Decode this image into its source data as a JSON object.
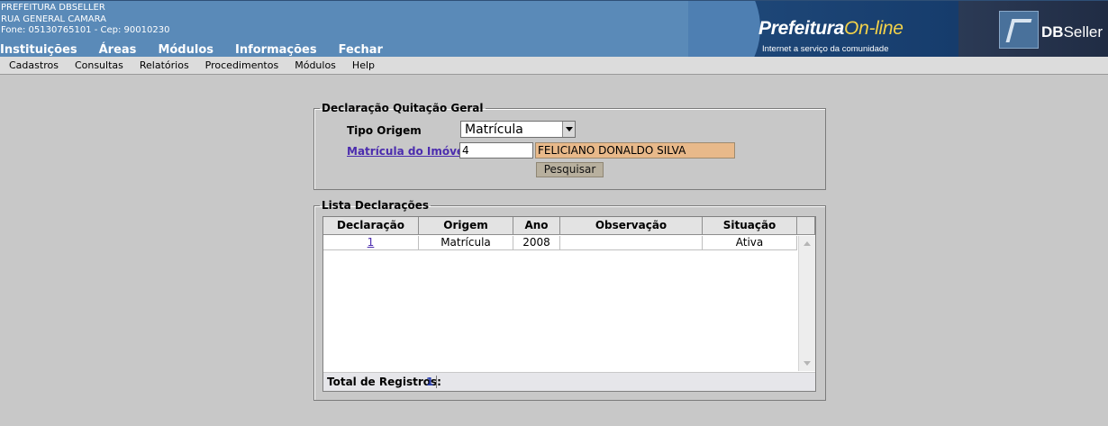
{
  "header": {
    "org_name": "PREFEITURA DBSELLER",
    "address": "RUA GENERAL CAMARA",
    "contact": "Fone: 05130765101  -  Cep: 90010230",
    "nav": [
      "Instituições",
      "Áreas",
      "Módulos",
      "Informações",
      "Fechar"
    ],
    "banner_title_main": "Prefeitura",
    "banner_title_accent": "On-line",
    "banner_subtitle": "Internet a serviço da comunidade",
    "brand_db": "DB",
    "brand_seller": "Seller",
    "colors": {
      "header_bg": "#5a8ab8",
      "banner_bg": "#163c6c",
      "accent": "#f3d24a"
    }
  },
  "menu": [
    "Cadastros",
    "Consultas",
    "Relatórios",
    "Procedimentos",
    "Módulos",
    "Help"
  ],
  "declaracao": {
    "legend": "Declaração Quitação Geral",
    "tipo_origem_label": "Tipo Origem",
    "tipo_origem_value": "Matrícula",
    "matricula_label": "Matrícula do Imóvel:",
    "matricula_value": "4",
    "nome_value": "FELICIANO DONALDO SILVA",
    "pesquisar_label": "Pesquisar"
  },
  "lista": {
    "legend": "Lista Declarações",
    "columns": [
      "Declaração",
      "Origem",
      "Ano",
      "Observação",
      "Situação"
    ],
    "rows": [
      {
        "declaracao": "1",
        "origem": "Matrícula",
        "ano": "2008",
        "observacao": "",
        "situacao": "Ativa"
      }
    ],
    "total_label": "Total de Registros:",
    "total_value": "1"
  }
}
